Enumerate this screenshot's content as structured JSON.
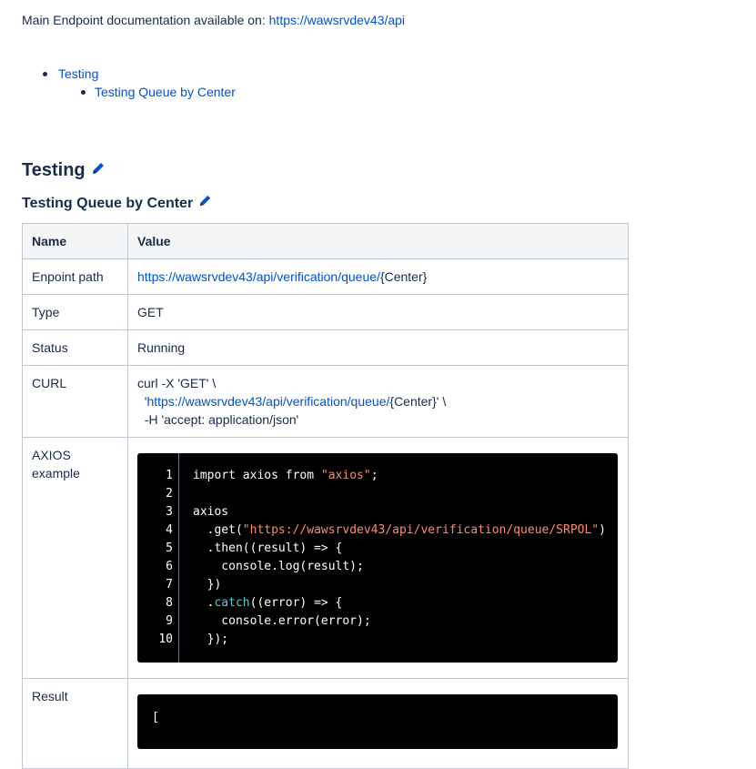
{
  "intro": {
    "text": "Main Endpoint documentation available on: ",
    "link": "https://wawsrvdev43/api"
  },
  "toc": [
    {
      "label": "Testing"
    },
    {
      "label": "Testing Queue by Center"
    }
  ],
  "sections": {
    "h2": "Testing",
    "h3": "Testing Queue by Center"
  },
  "table": {
    "headers": [
      "Name",
      "Value"
    ],
    "rows": {
      "path": {
        "name": "Enpoint path",
        "link": "https://wawsrvdev43/api/verification/queue/",
        "suffix": "{Center}"
      },
      "type": {
        "name": "Type",
        "value": "GET"
      },
      "status": {
        "name": "Status",
        "value": "Running"
      },
      "curl": {
        "name": "CURL",
        "line1": "curl -X 'GET' \\",
        "line2_prefix": "  '",
        "line2_link": "https://wawsrvdev43/api/verification/queue/",
        "line2_suffix": "{Center}' \\",
        "line3": "  -H 'accept: application/json'"
      },
      "axios": {
        "name": "AXIOS example"
      },
      "result": {
        "name": "Result",
        "code_first_line": "["
      }
    }
  },
  "code": {
    "line_numbers": [
      "1",
      "2",
      "3",
      "4",
      "5",
      "6",
      "7",
      "8",
      "9",
      "10"
    ],
    "lines": {
      "l1_a": "import axios from ",
      "l1_str": "\"axios\"",
      "l1_b": ";",
      "l3": "axios",
      "l4_a": "  .get(",
      "l4_str": "\"https://wawsrvdev43/api/verification/queue/SRPOL\"",
      "l4_b": ")",
      "l5": "  .then((result) => {",
      "l6": "    console.log(result);",
      "l7": "  })",
      "l8_a": "  .",
      "l8_kw": "catch",
      "l8_b": "((error) => {",
      "l9": "    console.error(error);",
      "l10": "  });"
    }
  },
  "colors": {
    "link": "#0052cc",
    "text": "#172b4d",
    "code_bg": "#000000",
    "string": "#ff8b6b",
    "keyword": "#4fd1d9"
  },
  "icons": [
    "pencil-icon"
  ]
}
